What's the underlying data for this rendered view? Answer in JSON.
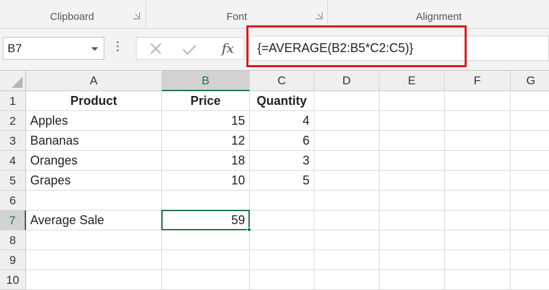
{
  "ribbon": {
    "groups": [
      {
        "label": "Clipboard"
      },
      {
        "label": "Font"
      },
      {
        "label": "Alignment"
      }
    ]
  },
  "formula_bar": {
    "name_box": "B7",
    "formula": "{=AVERAGE(B2:B5*C2:C5)}",
    "fx_label": "fx",
    "highlight_color": "#e2141c"
  },
  "sheet": {
    "columns": [
      "A",
      "B",
      "C",
      "D",
      "E",
      "F",
      "G"
    ],
    "selected_column": "B",
    "rows": [
      {
        "num": "1",
        "cells": [
          "Product",
          "Price",
          "Quantity",
          "",
          "",
          "",
          ""
        ]
      },
      {
        "num": "2",
        "cells": [
          "Apples",
          "15",
          "4",
          "",
          "",
          "",
          ""
        ]
      },
      {
        "num": "3",
        "cells": [
          "Bananas",
          "12",
          "6",
          "",
          "",
          "",
          ""
        ]
      },
      {
        "num": "4",
        "cells": [
          "Oranges",
          "18",
          "3",
          "",
          "",
          "",
          ""
        ]
      },
      {
        "num": "5",
        "cells": [
          "Grapes",
          "10",
          "5",
          "",
          "",
          "",
          ""
        ]
      },
      {
        "num": "6",
        "cells": [
          "",
          "",
          "",
          "",
          "",
          "",
          ""
        ]
      },
      {
        "num": "7",
        "cells": [
          "Average Sale",
          "59",
          "",
          "",
          "",
          "",
          ""
        ]
      },
      {
        "num": "8",
        "cells": [
          "",
          "",
          "",
          "",
          "",
          "",
          ""
        ]
      },
      {
        "num": "9",
        "cells": [
          "",
          "",
          "",
          "",
          "",
          "",
          ""
        ]
      },
      {
        "num": "10",
        "cells": [
          "",
          "",
          "",
          "",
          "",
          "",
          ""
        ]
      }
    ],
    "active_cell": "B7",
    "accent_color": "#217346"
  }
}
